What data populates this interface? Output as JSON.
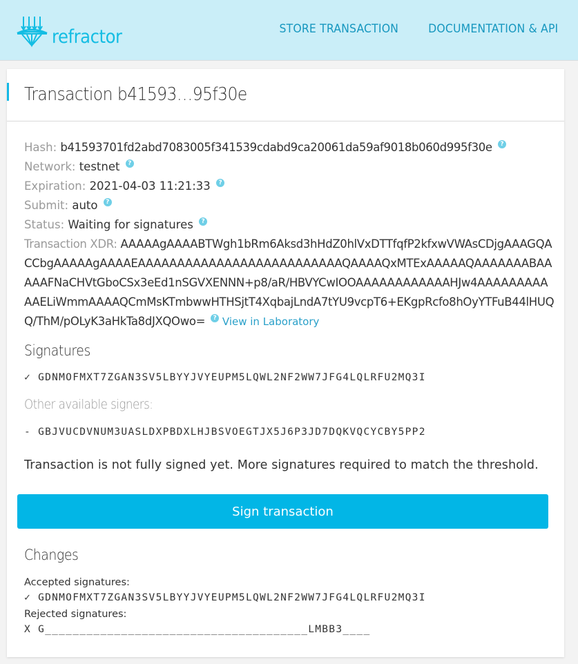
{
  "header": {
    "logo_text": "refractor",
    "nav": [
      {
        "label": "STORE TRANSACTION"
      },
      {
        "label": "DOCUMENTATION & API"
      }
    ]
  },
  "transaction": {
    "title": "Transaction b41593…95f30e",
    "fields": {
      "hash_label": "Hash:",
      "hash": "b41593701fd2abd7083005f341539cdabd9ca20061da59af9018b060d995f30e",
      "network_label": "Network:",
      "network": "testnet",
      "expiration_label": "Expiration:",
      "expiration": "2021-04-03 11:21:33",
      "submit_label": "Submit:",
      "submit": "auto",
      "status_label": "Status:",
      "status": "Waiting for signatures",
      "xdr_label": "Transaction XDR:",
      "xdr": "AAAAAgAAAABTWgh1bRm6Aksd3hHdZ0hlVxDTTfqfP2kfxwVWAsCDjgAAAGQACCbgAAAAAgAAAAEAAAAAAAAAAAAAAAAAAAAAAAAAAQAAAAQxMTExAAAAAQAAAAAAABAAAAAFNaCHVtGboCSx3eEd1nSGVXENNN+p8/aR/HBVYCwIOOAAAAAAAAAAAAHJw4AAAAAAAAAAAELiWmmAAAAQCmMsKTmbwwHTHSjtT4XqbajLndA7tYU9vcpT6+EKgpRcfo8hOyYTFuB44lHUQQ/ThM/pOLyK3aHkTa8dJXQOwo=",
      "lab_link": "View in Laboratory",
      "help_glyph": "?"
    },
    "signatures": {
      "heading": "Signatures",
      "signed": [
        {
          "mark": "✓",
          "key": "GDNMOFMXT7ZGAN3SV5LBYYJVYEUPM5LQWL2NF2WW7JFG4LQLRFU2MQ3I"
        }
      ],
      "other_heading": "Other available signers:",
      "other": [
        {
          "mark": "-",
          "key": "GBJVUCDVNUM3UASLDXPBDXLHJBSVOEGTJX5J6P3JD7DQKVQCYCBY5PP2"
        }
      ]
    },
    "note": "Transaction is not fully signed yet. More signatures required to match the threshold.",
    "sign_button": "Sign transaction",
    "changes": {
      "heading": "Changes",
      "accepted_label": "Accepted signatures:",
      "accepted": [
        {
          "mark": "✓",
          "key": "GDNMOFMXT7ZGAN3SV5LBYYJVYEUPM5LQWL2NF2WW7JFG4LQLRFU2MQ3I"
        }
      ],
      "rejected_label": "Rejected signatures:",
      "rejected": [
        {
          "mark": "X",
          "key": "G______________________________________LMBB3____"
        }
      ]
    }
  },
  "colors": {
    "header_bg": "#caeef8",
    "brand": "#14bde3",
    "nav_link": "#1697bf",
    "button": "#02b6e6",
    "help_icon": "#6fcfe7"
  }
}
